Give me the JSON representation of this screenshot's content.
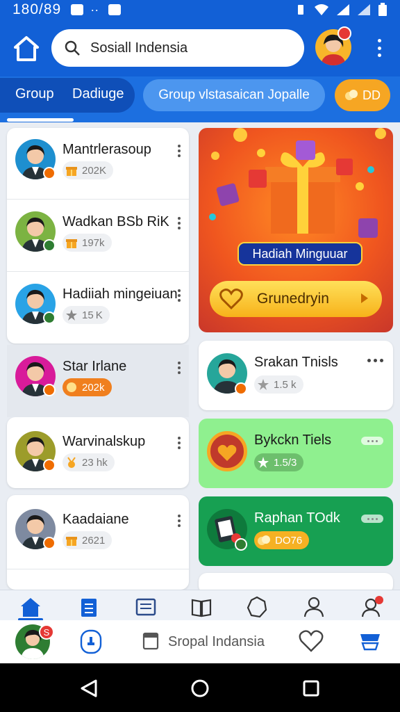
{
  "status_bar": {
    "time": "180/89"
  },
  "header": {
    "search_text": "Sosiall Indensia"
  },
  "tabs": {
    "tab1": "Group",
    "tab2": "Dadiuge",
    "chip": "Group vlstasaican Jopalle",
    "dd": "DD"
  },
  "left_list": [
    {
      "name": "Mantrlerasoup",
      "stat": "202K",
      "stat_icon": "gift-icon",
      "avatar_bg": "#1e8fcf",
      "badge": "#ef6c00"
    },
    {
      "name": "Wadkan BSb RiK",
      "stat": "197k",
      "stat_icon": "gift-icon",
      "avatar_bg": "#7cb342",
      "badge": "#2e7d32"
    },
    {
      "name": "Hadiiah mingeiuan",
      "stat": "15 K",
      "stat_icon": "star-icon",
      "avatar_bg": "#29a3e6",
      "badge": "#2e7d32"
    },
    {
      "name": "Star Irlane",
      "stat": "202k",
      "stat_icon": "coin-icon",
      "avatar_bg": "#d81b9a",
      "badge": "#ef6c00"
    },
    {
      "name": "Warvinalskup",
      "stat": "23 hk",
      "stat_icon": "medal-icon",
      "avatar_bg": "#9c9c2a",
      "badge": "#ef6c00"
    },
    {
      "name": "Kaadaiane",
      "stat": "2621",
      "stat_icon": "gift-icon",
      "avatar_bg": "#7e8aa0",
      "badge": "#ef6c00"
    }
  ],
  "promo": {
    "title": "Hadiah Minguuar",
    "button": "Grunedryin"
  },
  "right_cards": [
    {
      "name": "Srakan Tnisls",
      "stat": "1.5 k",
      "bg": "#ffffff"
    },
    {
      "name": "Bykckn Tiels",
      "stat": "1.5/3",
      "bg": "#8ff08f"
    },
    {
      "name": "Raphan TOdk",
      "stat": "DO76",
      "bg": "#17a052"
    }
  ],
  "dock": {
    "text": "Sropal Indansia",
    "badge": "S"
  },
  "colors": {
    "primary": "#1260d6",
    "accent": "#f6a623"
  }
}
